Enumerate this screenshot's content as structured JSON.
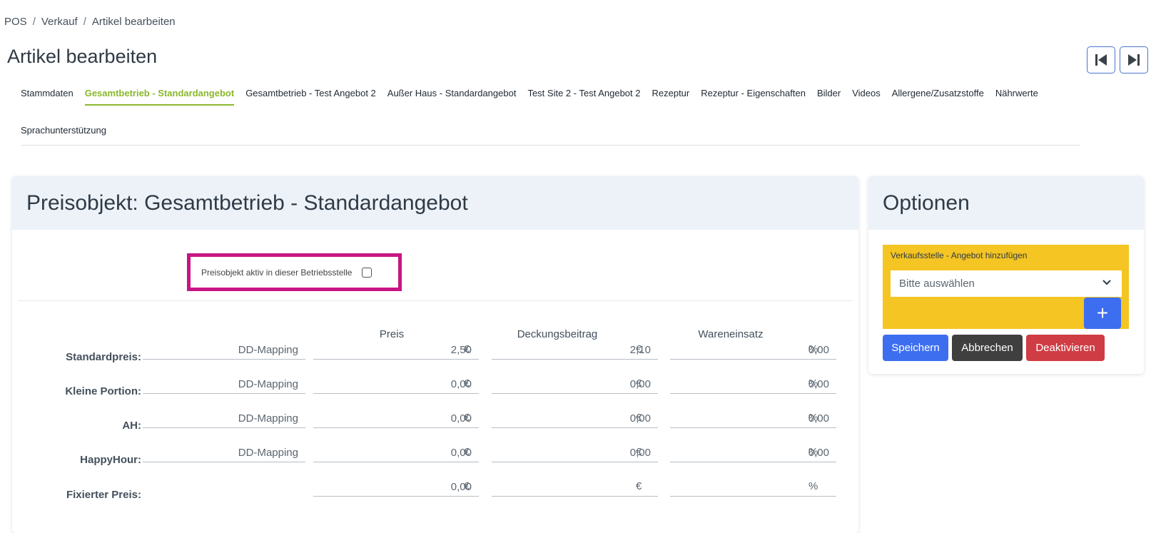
{
  "breadcrumb": [
    "POS",
    "Verkauf",
    "Artikel bearbeiten"
  ],
  "page_title": "Artikel bearbeiten",
  "tabs": [
    {
      "label": "Stammdaten",
      "active": false
    },
    {
      "label": "Gesamtbetrieb - Standardangebot",
      "active": true
    },
    {
      "label": "Gesamtbetrieb - Test Angebot 2",
      "active": false
    },
    {
      "label": "Außer Haus - Standardangebot",
      "active": false
    },
    {
      "label": "Test Site 2 - Test Angebot 2",
      "active": false
    },
    {
      "label": "Rezeptur",
      "active": false
    },
    {
      "label": "Rezeptur - Eigenschaften",
      "active": false
    },
    {
      "label": "Bilder",
      "active": false
    },
    {
      "label": "Videos",
      "active": false
    },
    {
      "label": "Allergene/Zusatzstoffe",
      "active": false
    },
    {
      "label": "Nährwerte",
      "active": false
    },
    {
      "label": "Sprachunterstützung",
      "active": false
    }
  ],
  "main": {
    "title": "Preisobjekt: Gesamtbetrieb - Standardangebot",
    "active_checkbox_label": "Preisobjekt aktiv in dieser Betriebsstelle",
    "active_checked": false,
    "columns": {
      "preis": "Preis",
      "deckung": "Deckungsbeitrag",
      "waren": "Wareneinsatz"
    },
    "rows": [
      {
        "label": "Standardpreis:",
        "mapping": "DD-Mapping",
        "preis": "2,50",
        "deckung": "2,10",
        "waren": "0,00"
      },
      {
        "label": "Kleine Portion:",
        "mapping": "DD-Mapping",
        "preis": "0,00",
        "deckung": "0,00",
        "waren": "0,00"
      },
      {
        "label": "AH:",
        "mapping": "DD-Mapping",
        "preis": "0,00",
        "deckung": "0,00",
        "waren": "0,00"
      },
      {
        "label": "HappyHour:",
        "mapping": "DD-Mapping",
        "preis": "0,00",
        "deckung": "0,00",
        "waren": "0,00"
      },
      {
        "label": "Fixierter Preis:",
        "mapping": "",
        "preis": "0,00",
        "deckung": "",
        "waren": ""
      }
    ],
    "currency_unit": "€",
    "percent_unit": "%"
  },
  "options": {
    "title": "Optionen",
    "add_offer_label": "Verkaufsstelle - Angebot hinzufügen",
    "select_placeholder": "Bitte auswählen",
    "add_button": "+",
    "save_label": "Speichern",
    "cancel_label": "Abbrechen",
    "deactivate_label": "Deaktivieren"
  },
  "colors": {
    "accent_tab": "#8ab72c",
    "highlight_border": "#c71585",
    "options_box": "#f4c523",
    "primary": "#3d6ef0",
    "danger": "#d03c44",
    "dark": "#3f3f3f"
  }
}
